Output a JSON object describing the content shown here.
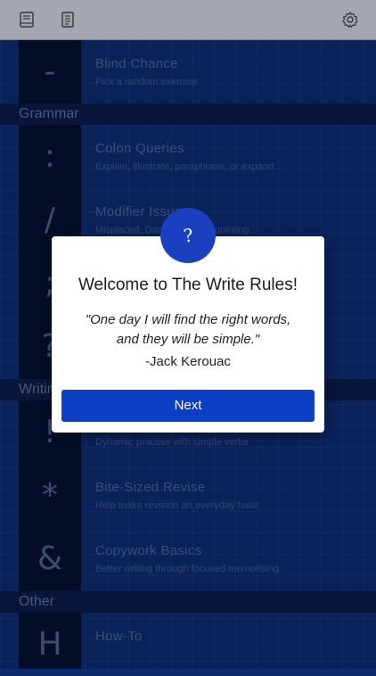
{
  "toolbar": {
    "left_icons": [
      "book-icon",
      "list-icon"
    ],
    "right_icon": "gear-icon"
  },
  "sections": {
    "grammar": "Grammar",
    "writing": "Writing",
    "other": "Other"
  },
  "exercises": [
    {
      "symbol": "-",
      "title": "Blind Chance",
      "subtitle": "Pick a random exercise"
    },
    {
      "symbol": ":",
      "title": "Colon Queries",
      "subtitle": "Explain, illustrate, paraphrase, or expand"
    },
    {
      "symbol": "/",
      "title": "Modifier Issues",
      "subtitle": "Misplaced, Dangling, and Squinting"
    },
    {
      "symbol": ";",
      "title": "",
      "subtitle": ""
    },
    {
      "symbol": "?",
      "title": "",
      "subtitle": ""
    },
    {
      "symbol": "!",
      "title": "",
      "subtitle": "Dynamic practise with simple verbs"
    },
    {
      "symbol": "*",
      "title": "Bite-Sized Revise",
      "subtitle": "Help make revision an everyday habit"
    },
    {
      "symbol": "&",
      "title": "Copywork Basics",
      "subtitle": "Better writing through focused memorising"
    },
    {
      "symbol": "H",
      "title": "How-To",
      "subtitle": ""
    }
  ],
  "dialog": {
    "badge_icon": "question-mark-icon",
    "badge_glyph": "?",
    "title": "Welcome to The Write Rules!",
    "quote_line1": "\"One day I will find the right words,",
    "quote_line2": "and they will be simple.\"",
    "author": "-Jack Kerouac",
    "button_label": "Next"
  },
  "colors": {
    "background": "#0d2a6e",
    "toolbar": "#c8ccd6",
    "accent": "#0d3fc6"
  }
}
